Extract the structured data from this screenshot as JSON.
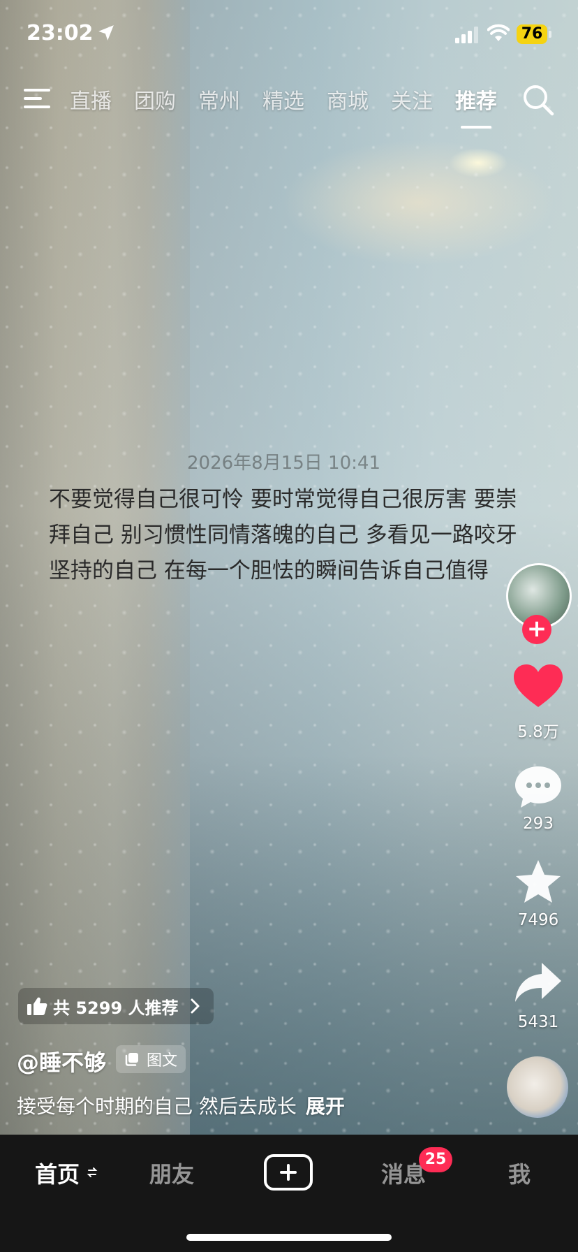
{
  "status_bar": {
    "time": "23:02",
    "battery": "76"
  },
  "top_nav": {
    "tabs": [
      {
        "label": "直播"
      },
      {
        "label": "团购"
      },
      {
        "label": "常州"
      },
      {
        "label": "精选"
      },
      {
        "label": "商城"
      },
      {
        "label": "关注"
      },
      {
        "label": "推荐"
      }
    ],
    "active_tab": "推荐"
  },
  "post": {
    "date": "2026年8月15日 10:41",
    "text": "不要觉得自己很可怜 要时常觉得自己很厉害 要崇拜自己 别习惯性同情落魄的自己 多看见一路咬牙坚持的自己 在每一个胆怯的瞬间告诉自己值得"
  },
  "actions": {
    "likes": "5.8万",
    "comments": "293",
    "favorites": "7496",
    "shares": "5431",
    "like_color": "#fe2c55"
  },
  "info": {
    "recommend": "共 5299 人推荐",
    "author": "@睡不够",
    "tag": "图文",
    "description": "接受每个时期的自己 然后去成长",
    "expand": "展开"
  },
  "bottom_nav": {
    "items": [
      {
        "label": "首页"
      },
      {
        "label": "朋友"
      },
      {
        "label": "消息"
      },
      {
        "label": "我"
      }
    ],
    "messages_badge": "25"
  }
}
